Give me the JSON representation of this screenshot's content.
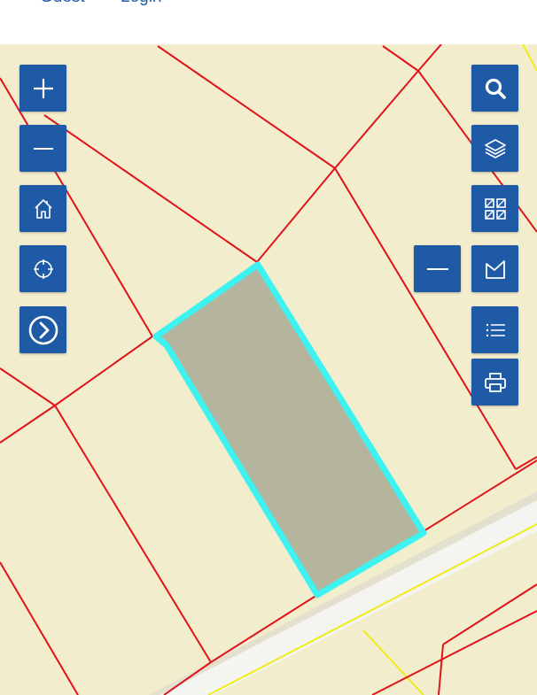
{
  "header": {
    "guest_label": "Guest",
    "login_label": "Login"
  },
  "map": {
    "background_color": "#f2edcc",
    "parcel_line_color": "#e0141c",
    "selected_parcel_outline_color": "#3ef2f2",
    "selected_parcel_fill_color": "#b5b49c",
    "road_color": "#f4f4f0",
    "road_edge_color": "#f0ec1a"
  },
  "controls": {
    "left": [
      {
        "name": "zoom-in-button",
        "icon": "plus-icon"
      },
      {
        "name": "zoom-out-button",
        "icon": "minus-icon"
      },
      {
        "name": "home-button",
        "icon": "home-icon"
      },
      {
        "name": "locate-button",
        "icon": "crosshair-icon"
      },
      {
        "name": "expand-button",
        "icon": "chevron-right-circle-icon"
      }
    ],
    "right": [
      {
        "name": "search-button",
        "icon": "search-icon"
      },
      {
        "name": "layers-button",
        "icon": "layers-icon"
      },
      {
        "name": "basemap-gallery-button",
        "icon": "basemap-grid-icon"
      },
      {
        "name": "collapse-panel-button",
        "icon": "minus-icon"
      },
      {
        "name": "measure-button",
        "icon": "measure-area-icon"
      },
      {
        "name": "legend-button",
        "icon": "list-icon"
      },
      {
        "name": "print-button",
        "icon": "printer-icon"
      }
    ],
    "accent_color": "#1f5aa6"
  }
}
